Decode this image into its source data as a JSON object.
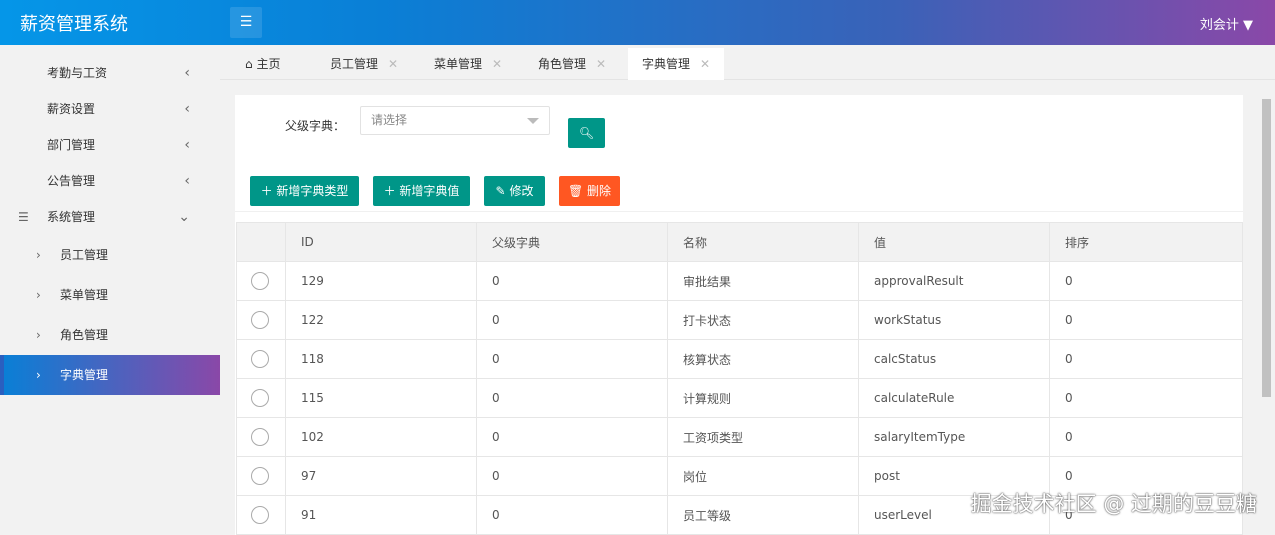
{
  "header": {
    "title": "薪资管理系统",
    "user": "刘会计"
  },
  "sidebar": {
    "items": [
      {
        "label": "考勤与工资"
      },
      {
        "label": "薪资设置"
      },
      {
        "label": "部门管理"
      },
      {
        "label": "公告管理"
      },
      {
        "label": "系统管理"
      }
    ],
    "sub": [
      {
        "label": "员工管理"
      },
      {
        "label": "菜单管理"
      },
      {
        "label": "角色管理"
      },
      {
        "label": "字典管理"
      }
    ]
  },
  "tabs": [
    {
      "label": "主页"
    },
    {
      "label": "员工管理"
    },
    {
      "label": "菜单管理"
    },
    {
      "label": "角色管理"
    },
    {
      "label": "字典管理"
    }
  ],
  "filter": {
    "label": "父级字典：",
    "placeholder": "请选择"
  },
  "toolbar": {
    "add_type": "新增字典类型",
    "add_value": "新增字典值",
    "edit": "修改",
    "delete": "删除"
  },
  "table": {
    "headers": [
      "ID",
      "父级字典",
      "名称",
      "值",
      "排序"
    ],
    "rows": [
      [
        "129",
        "0",
        "审批结果",
        "approvalResult",
        "0"
      ],
      [
        "122",
        "0",
        "打卡状态",
        "workStatus",
        "0"
      ],
      [
        "118",
        "0",
        "核算状态",
        "calcStatus",
        "0"
      ],
      [
        "115",
        "0",
        "计算规则",
        "calculateRule",
        "0"
      ],
      [
        "102",
        "0",
        "工资项类型",
        "salaryItemType",
        "0"
      ],
      [
        "97",
        "0",
        "岗位",
        "post",
        "0"
      ],
      [
        "91",
        "0",
        "员工等级",
        "userLevel",
        "0"
      ]
    ]
  },
  "watermark": "掘金技术社区 @ 过期的豆豆糖"
}
